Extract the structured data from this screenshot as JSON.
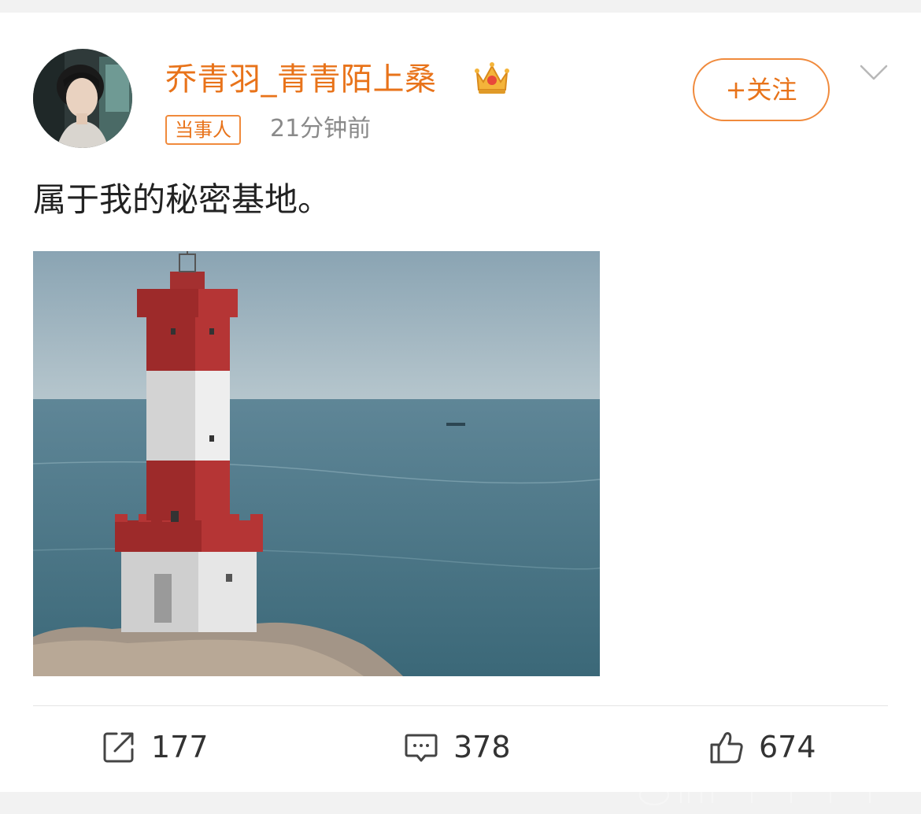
{
  "post": {
    "username": "乔青羽_青青陌上桑",
    "badge": "当事人",
    "time": "21分钟前",
    "follow_label": "+关注",
    "text": "属于我的秘密基地。"
  },
  "icons": {
    "avatar": "avatar",
    "crown": "crown-icon",
    "more": "chevron-down-icon",
    "repost": "share-icon",
    "comment": "comment-icon",
    "like": "thumbs-up-icon"
  },
  "stats": {
    "reposts": "177",
    "comments": "378",
    "likes": "674"
  },
  "colors": {
    "accent": "#e8731a",
    "text": "#222222",
    "muted": "#8a8a8a"
  }
}
